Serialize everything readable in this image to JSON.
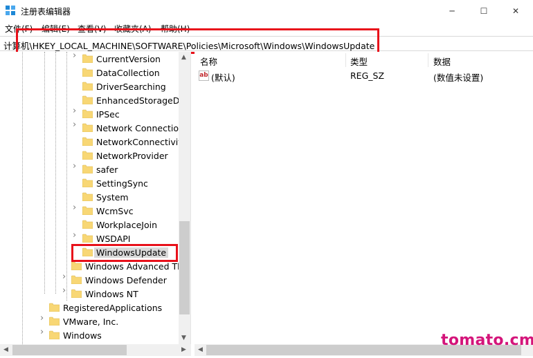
{
  "window": {
    "title": "注册表编辑器",
    "app_icon": "regedit-icon",
    "controls": {
      "minimize": "─",
      "maximize": "☐",
      "close": "✕"
    }
  },
  "menubar": {
    "items": [
      "文件(F)",
      "编辑(E)",
      "查看(V)",
      "收藏夹(A)",
      "帮助(H)"
    ]
  },
  "address": {
    "path": "计算机\\HKEY_LOCAL_MACHINE\\SOFTWARE\\Policies\\Microsoft\\Windows\\WindowsUpdate"
  },
  "tree": {
    "items": [
      {
        "label": "CurrentVersion",
        "expandable": true
      },
      {
        "label": "DataCollection",
        "expandable": false
      },
      {
        "label": "DriverSearching",
        "expandable": false
      },
      {
        "label": "EnhancedStorageDev",
        "expandable": false
      },
      {
        "label": "IPSec",
        "expandable": true
      },
      {
        "label": "Network Connection",
        "expandable": true
      },
      {
        "label": "NetworkConnectivity",
        "expandable": false
      },
      {
        "label": "NetworkProvider",
        "expandable": false
      },
      {
        "label": "safer",
        "expandable": true
      },
      {
        "label": "SettingSync",
        "expandable": false
      },
      {
        "label": "System",
        "expandable": false
      },
      {
        "label": "WcmSvc",
        "expandable": true
      },
      {
        "label": "WorkplaceJoin",
        "expandable": false
      },
      {
        "label": "WSDAPI",
        "expandable": true
      },
      {
        "label": "WindowsUpdate",
        "expandable": false,
        "selected": true
      },
      {
        "label": "Windows Advanced Thr",
        "expandable": false
      },
      {
        "label": "Windows Defender",
        "expandable": true
      },
      {
        "label": "Windows NT",
        "expandable": true
      },
      {
        "label": "RegisteredApplications",
        "expandable": false
      },
      {
        "label": "VMware, Inc.",
        "expandable": true
      },
      {
        "label": "Windows",
        "expandable": true
      }
    ]
  },
  "list": {
    "columns": [
      "名称",
      "类型",
      "数据"
    ],
    "rows": [
      {
        "icon": "string-value-icon",
        "icon_text": "ab",
        "name": "(默认)",
        "type": "REG_SZ",
        "data": "(数值未设置)"
      }
    ]
  },
  "watermark": {
    "text": "tomato.cm"
  },
  "colors": {
    "highlight_box": "#e8101a",
    "folder": "#f8d775",
    "watermark": "#d4147a"
  }
}
